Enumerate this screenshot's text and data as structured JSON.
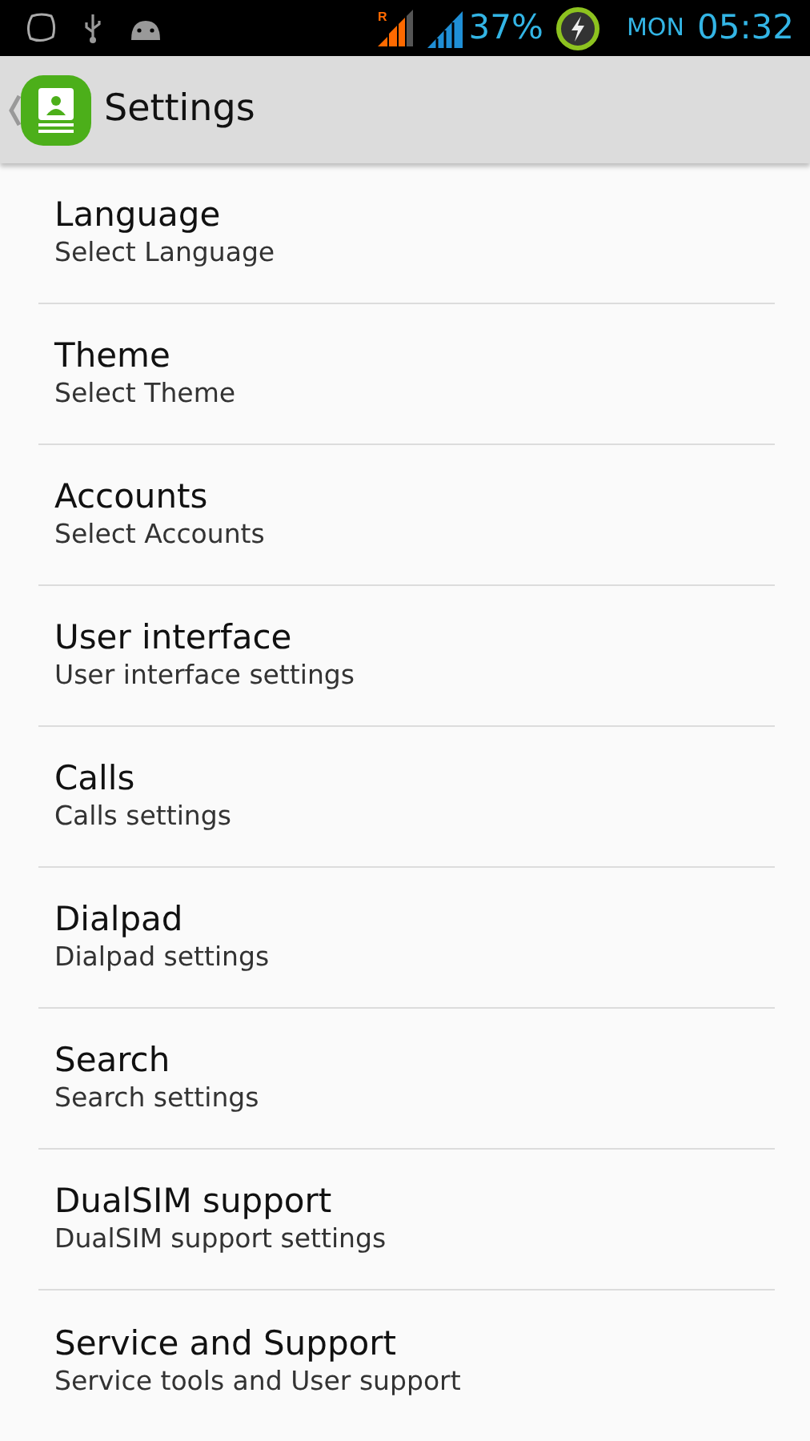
{
  "status_bar": {
    "roaming_mark": "R",
    "battery": "37%",
    "day": "MON",
    "time": "05:32"
  },
  "action_bar": {
    "title": "Settings"
  },
  "items": [
    {
      "title": "Language",
      "subtitle": "Select Language"
    },
    {
      "title": "Theme",
      "subtitle": "Select Theme"
    },
    {
      "title": "Accounts",
      "subtitle": "Select Accounts"
    },
    {
      "title": "User interface",
      "subtitle": "User interface settings"
    },
    {
      "title": "Calls",
      "subtitle": "Calls settings"
    },
    {
      "title": "Dialpad",
      "subtitle": "Dialpad settings"
    },
    {
      "title": "Search",
      "subtitle": "Search settings"
    },
    {
      "title": "DualSIM support",
      "subtitle": "DualSIM support settings"
    },
    {
      "title": "Service and Support",
      "subtitle": "Service tools and User support"
    }
  ]
}
